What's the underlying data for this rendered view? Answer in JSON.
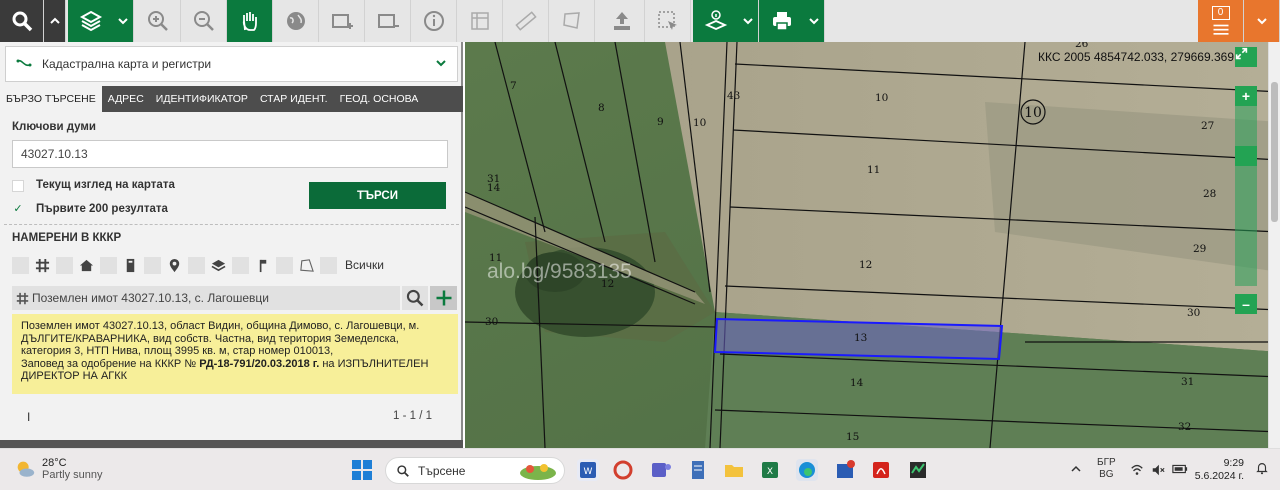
{
  "toolbar": {
    "tools": [
      "search-icon",
      "chevron-up-icon",
      "layers-icon",
      "chevron-down-icon",
      "zoom-in-icon",
      "zoom-out-icon",
      "pan-hand-icon",
      "globe-icon",
      "add-frame-icon",
      "remove-frame-icon",
      "info-icon",
      "measure-table-icon",
      "ruler-icon",
      "polygon-icon",
      "upload-icon",
      "select-area-icon",
      "identify-layer-icon",
      "print-icon"
    ],
    "notification_count": "0"
  },
  "panel": {
    "layer_select": "Кадастрална карта и регистри",
    "tabs": [
      "БЪРЗО ТЪРСЕНЕ",
      "АДРЕС",
      "ИДЕНТИФИКАТОР",
      "СТАР ИДЕНТ.",
      "ГЕОД. ОСНОВА"
    ],
    "keywords_label": "Ключови думи",
    "keywords_value": "43027.10.13",
    "current_view_label": "Текущ изглед на картата",
    "first_200_label": "Първите 200 резултата",
    "first_200_check": "✓",
    "search_button": "ТЪРСИ",
    "found_label": "НАМЕРЕНИ В КККР",
    "filter_all": "Всички",
    "result_title": "Поземлен имот 43027.10.13, с. Лагошевци",
    "result_text_1": "Поземлен имот 43027.10.13, област Видин, община Димово, с. Лагошевци, м. ДЪЛГИТЕ/КРАВАРНИКА, вид собств. Частна, вид територия Земеделска, категория 3, НТП Нива, площ 3995 кв. м, стар номер 010013,",
    "result_text_2": "Заповед за одобрение на КККР № ",
    "result_order": "РД-18-791/20.03.2018 г.",
    "result_text_3": " на ИЗПЪЛНИТЕЛЕН ДИРЕКТОР НА АГКК",
    "pager_left": "I",
    "pager": "1 - 1 / 1"
  },
  "map": {
    "coords": "ККС 2005 4854742.033, 279669.369",
    "watermark": "alo.bg/9583135",
    "parcel_labels": [
      {
        "t": "26"
      },
      {
        "t": "7"
      },
      {
        "t": "8"
      },
      {
        "t": "9"
      },
      {
        "t": "10"
      },
      {
        "t": "43"
      },
      {
        "t": "10"
      },
      {
        "t": "27"
      },
      {
        "t": "11"
      },
      {
        "t": "31"
      },
      {
        "t": "14"
      },
      {
        "t": "28"
      },
      {
        "t": "29"
      },
      {
        "t": "11"
      },
      {
        "t": "12"
      },
      {
        "t": "12"
      },
      {
        "t": "30"
      },
      {
        "t": "13"
      },
      {
        "t": "30"
      },
      {
        "t": "14"
      },
      {
        "t": "31"
      },
      {
        "t": "32"
      },
      {
        "t": "15"
      }
    ],
    "circle_label": "10",
    "zoom_in": "+",
    "zoom_out": "–",
    "colors": {
      "selection": "#1a1aff",
      "accent": "#0b7a3e"
    }
  },
  "taskbar": {
    "temp": "28°C",
    "weather": "Partly sunny",
    "search_placeholder": "Търсене",
    "lang_1": "БГР",
    "lang_2": "BG",
    "time": "9:29",
    "date": "5.6.2024 г."
  }
}
